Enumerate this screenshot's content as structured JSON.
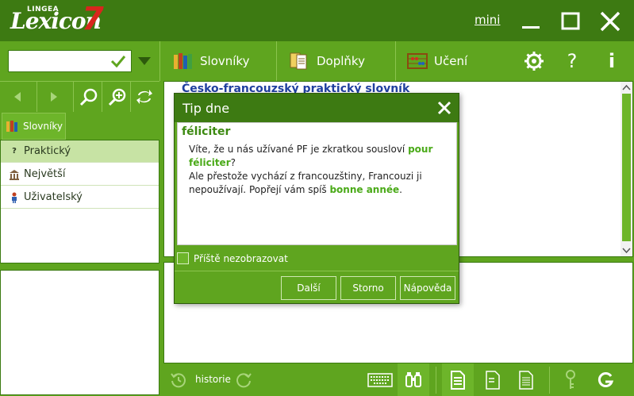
{
  "window": {
    "logo_small": "LINGEA",
    "logo_name": "Lexicon",
    "logo_version": "7",
    "mini_label": "mini"
  },
  "search": {
    "value": "",
    "placeholder": ""
  },
  "toolbar": {
    "tabs": [
      {
        "label": "Slovníky",
        "icon": "books-icon"
      },
      {
        "label": "Doplňky",
        "icon": "documents-icon"
      },
      {
        "label": "Učení",
        "icon": "abacus-icon"
      }
    ],
    "settings_icon": "gear-icon",
    "help_glyph": "?",
    "info_glyph": "i"
  },
  "left_panel": {
    "tab_label": "Slovníky",
    "items": [
      {
        "label": "Praktický",
        "icon": "question-icon",
        "selected": true
      },
      {
        "label": "Největší",
        "icon": "library-icon",
        "selected": false
      },
      {
        "label": "Uživatelský",
        "icon": "person-icon",
        "selected": false
      }
    ]
  },
  "main": {
    "title": "Česko-francouzský praktický slovník"
  },
  "bottom_bar": {
    "history_label": "historie"
  },
  "dialog": {
    "title": "Tip dne",
    "word": "féliciter",
    "text_1": "Víte, že u nás užívané PF je zkratkou sousloví ",
    "highlight_1": "pour féliciter",
    "text_2": "?",
    "text_3": "Ale přestože vychází z francouzštiny, Francouzi ji nepoužívají. Popřejí vám spíš ",
    "highlight_2": "bonne année",
    "text_4": ".",
    "checkbox_label": "Příště nezobrazovat",
    "buttons": {
      "next": "Další",
      "cancel": "Storno",
      "help": "Nápověda"
    }
  },
  "colors": {
    "brand_green": "#5fa51f",
    "dark_green": "#3d7a12",
    "logo_red": "#d8261d",
    "highlight_green": "#4aaa18",
    "title_blue": "#2040a0"
  }
}
